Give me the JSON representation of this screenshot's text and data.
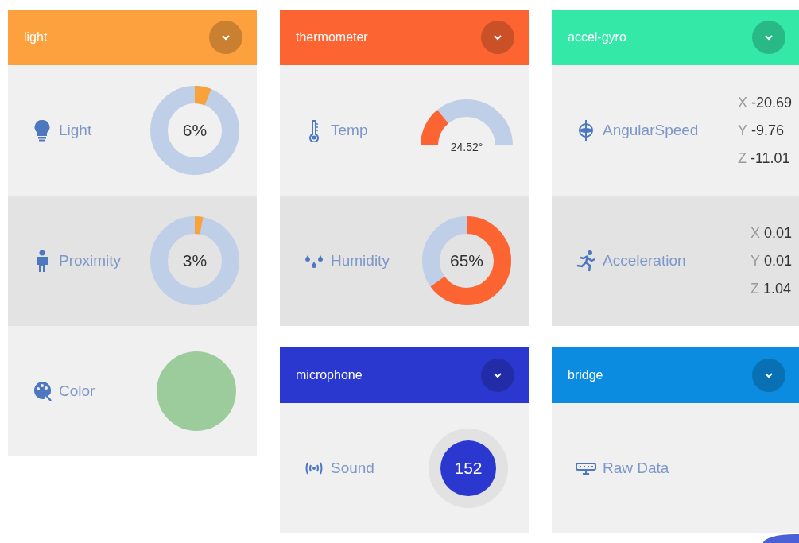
{
  "columns": [
    {
      "cards": [
        {
          "title": "light",
          "color": "#fda13e",
          "rows": [
            {
              "label": "Light",
              "kind": "donut",
              "level": 0.06,
              "reading": "6%",
              "color": "#f9a23b"
            },
            {
              "label": "Proximity",
              "kind": "donut",
              "level": 0.03,
              "reading": "3%",
              "color": "#f9a23b"
            },
            {
              "label": "Color",
              "kind": "swatch",
              "color": "#9ccb9c"
            }
          ]
        }
      ]
    },
    {
      "cards": [
        {
          "title": "thermometer",
          "color": "#fc6531",
          "rows": [
            {
              "label": "Temp",
              "kind": "gauge",
              "reading": "24.52°",
              "color": "#fc6531"
            },
            {
              "label": "Humidity",
              "kind": "donut",
              "level": 0.65,
              "reading": "65%",
              "color": "#fc6531"
            }
          ]
        },
        {
          "title": "microphone",
          "color": "#2b38d0",
          "rows": [
            {
              "label": "Sound",
              "kind": "badge",
              "reading": "152",
              "color": "#2b38d0"
            }
          ]
        }
      ]
    },
    {
      "cards": [
        {
          "title": "accel-gyro",
          "color": "#34e8a8",
          "rows": [
            {
              "label": "AngularSpeed",
              "kind": "xyz",
              "values": [
                {
                  "axis": "X",
                  "value": "-20.69"
                },
                {
                  "axis": "Y",
                  "value": "-9.76"
                },
                {
                  "axis": "Z",
                  "value": "-11.01"
                }
              ]
            },
            {
              "label": "Acceleration",
              "kind": "xyz",
              "values": [
                {
                  "axis": "X",
                  "value": "0.01"
                },
                {
                  "axis": "Y",
                  "value": "0.01"
                },
                {
                  "axis": "Z",
                  "value": "1.04"
                }
              ]
            }
          ]
        },
        {
          "title": "bridge",
          "color": "#0c8ce0",
          "rows": [
            {
              "label": "Raw Data",
              "kind": "plain"
            }
          ]
        }
      ]
    }
  ]
}
